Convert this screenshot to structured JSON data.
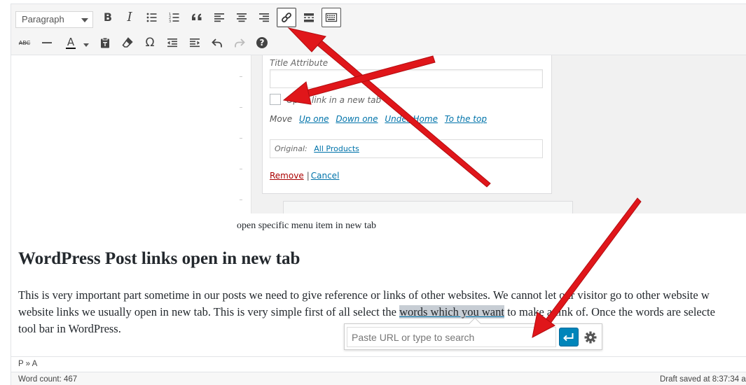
{
  "toolbar": {
    "format_select": "Paragraph",
    "row1_icons": [
      "bold-icon",
      "italic-icon",
      "bulleted-list-icon",
      "numbered-list-icon",
      "blockquote-icon",
      "align-left-icon",
      "align-center-icon",
      "align-right-icon",
      "insert-link-icon",
      "read-more-icon",
      "toolbar-toggle-icon"
    ],
    "row2_icons": [
      "strikethrough-icon",
      "horizontal-line-icon",
      "text-color-icon",
      "paste-as-text-icon",
      "clear-formatting-icon",
      "special-character-icon",
      "decrease-indent-icon",
      "increase-indent-icon",
      "undo-icon",
      "redo-icon",
      "help-icon"
    ],
    "bold_glyph": "B",
    "italic_glyph": "I",
    "strike_glyph": "ABC",
    "color_glyph": "A",
    "omega_glyph": "Ω",
    "help_glyph": "?"
  },
  "embedded_screenshot": {
    "title_attribute_label": "Title Attribute",
    "open_new_tab_label": "Open link in a new tab",
    "move_label": "Move",
    "move_links": [
      "Up one",
      "Down one",
      "Under Home",
      "To the top"
    ],
    "original_label": "Original:",
    "original_link": "All Products",
    "remove_label": "Remove",
    "separator": "|",
    "cancel_label": "Cancel"
  },
  "content": {
    "caption": "open specific menu item in new tab",
    "heading": "WordPress Post links open in new tab",
    "paragraph_line1": "This is very important part sometime in our posts we need to give reference or links of other websites. We cannot let our visitor go to other website w",
    "paragraph_line2_before": "website links we usually open in new tab. This is very simple first of all select the ",
    "paragraph_line2_selected": "words which you want",
    "paragraph_line2_after": " to make a link of. Once the words are selecte",
    "paragraph_line3": "tool bar in WordPress."
  },
  "link_popup": {
    "placeholder": "Paste URL or type to search",
    "apply_icon": "enter-arrow-icon",
    "settings_icon": "gear-icon"
  },
  "status": {
    "path": "P » A",
    "word_count": "Word count: 467",
    "draft_saved": "Draft saved at 8:37:34 a"
  },
  "colors": {
    "annotation_arrow": "#e0161a",
    "link": "#0073aa",
    "apply_button": "#0085ba",
    "remove_link": "#aa0000",
    "selection": "#c7cdd4"
  }
}
